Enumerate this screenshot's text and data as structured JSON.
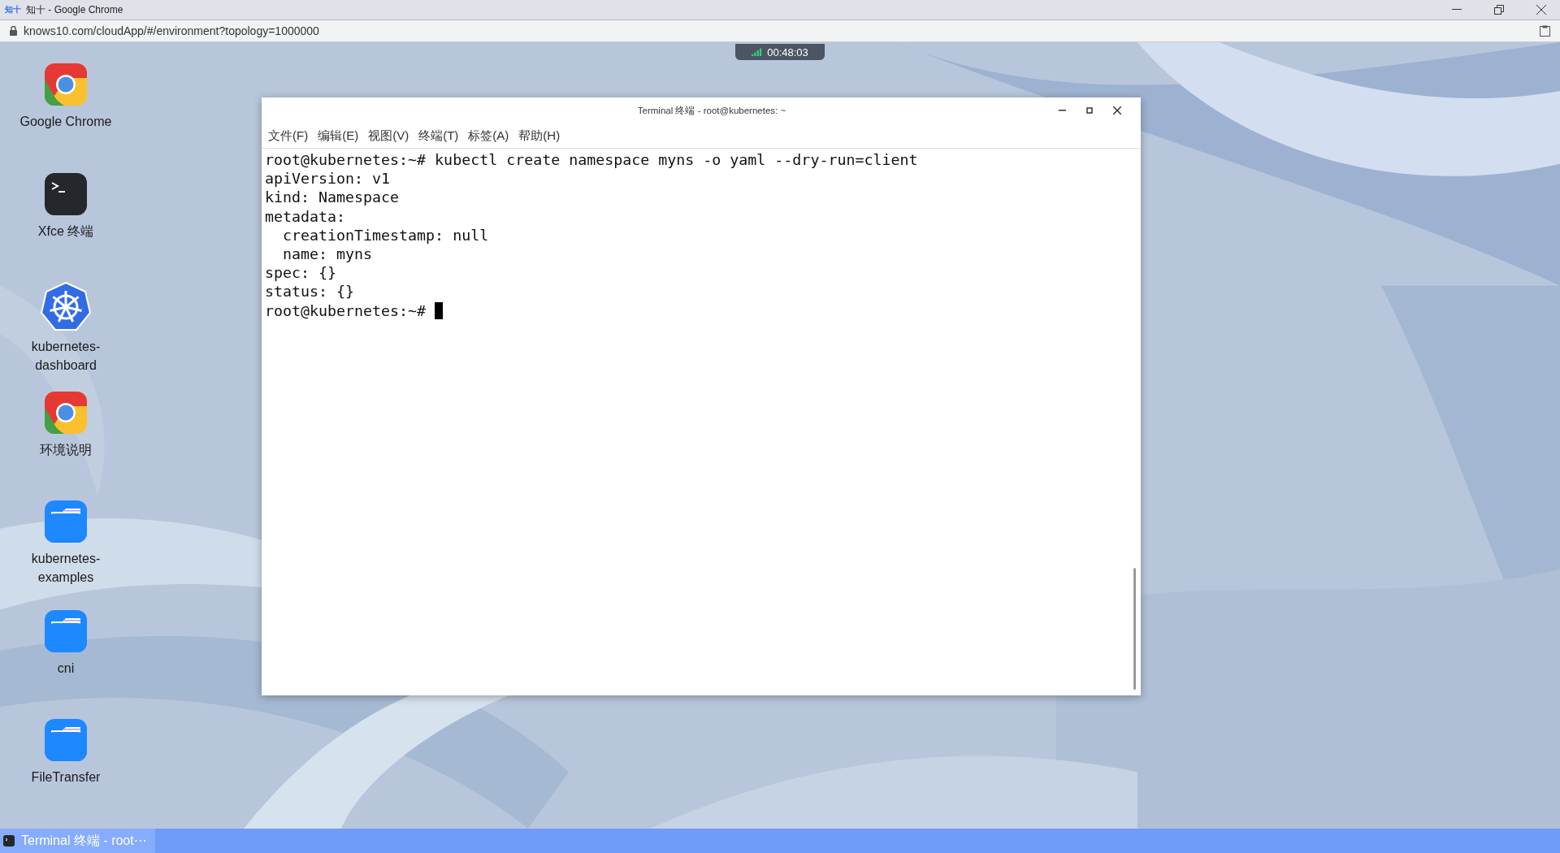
{
  "browser": {
    "tab_title": "知十 - Google Chrome",
    "favicon": "知十",
    "url": "knows10.com/cloudApp/#/environment?topology=1000000"
  },
  "session_timer": "00:48:03",
  "desktop_icons": [
    {
      "label": "Google Chrome",
      "kind": "chrome"
    },
    {
      "label": "Xfce 终端",
      "kind": "terminal"
    },
    {
      "label": "kubernetes-dashboard",
      "kind": "kubernetes"
    },
    {
      "label": "环境说明",
      "kind": "chrome"
    },
    {
      "label": "kubernetes-examples",
      "kind": "folder"
    },
    {
      "label": "cni",
      "kind": "folder"
    },
    {
      "label": "FileTransfer",
      "kind": "folder"
    }
  ],
  "terminal": {
    "title": "Terminal 终端 - root@kubernetes: ~",
    "menu": [
      "文件(F)",
      "编辑(E)",
      "视图(V)",
      "终端(T)",
      "标签(A)",
      "帮助(H)"
    ],
    "lines": [
      "root@kubernetes:~# kubectl create namespace myns -o yaml --dry-run=client",
      "apiVersion: v1",
      "kind: Namespace",
      "metadata:",
      "  creationTimestamp: null",
      "  name: myns",
      "spec: {}",
      "status: {}"
    ],
    "prompt": "root@kubernetes:~#"
  },
  "taskbar": {
    "items": [
      {
        "label": "Terminal 终端 - root⋯",
        "selected": true
      }
    ]
  }
}
